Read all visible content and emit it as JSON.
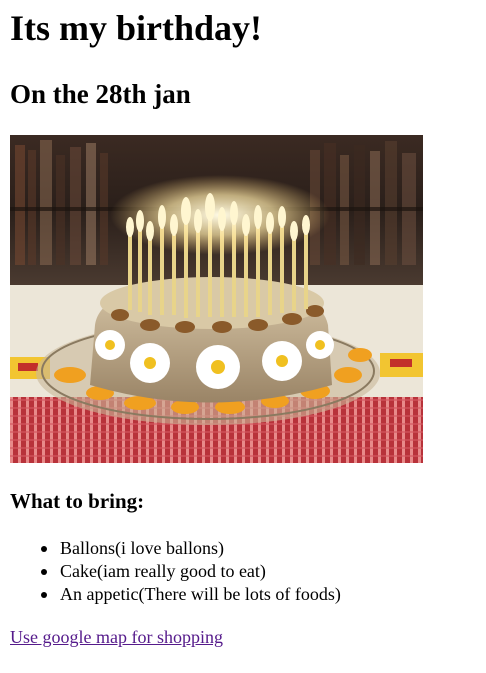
{
  "page": {
    "heading": "Its my birthday!",
    "subheading": "On the 28th jan"
  },
  "image": {
    "description_icon": "birthday-cake-photo"
  },
  "bring": {
    "heading": "What to bring:",
    "items": [
      "Ballons(i love ballons)",
      "Cake(iam really good to eat)",
      "An appetic(There will be lots of foods)"
    ]
  },
  "link": {
    "label": "Use google map for shopping",
    "color": "#551a8b"
  }
}
